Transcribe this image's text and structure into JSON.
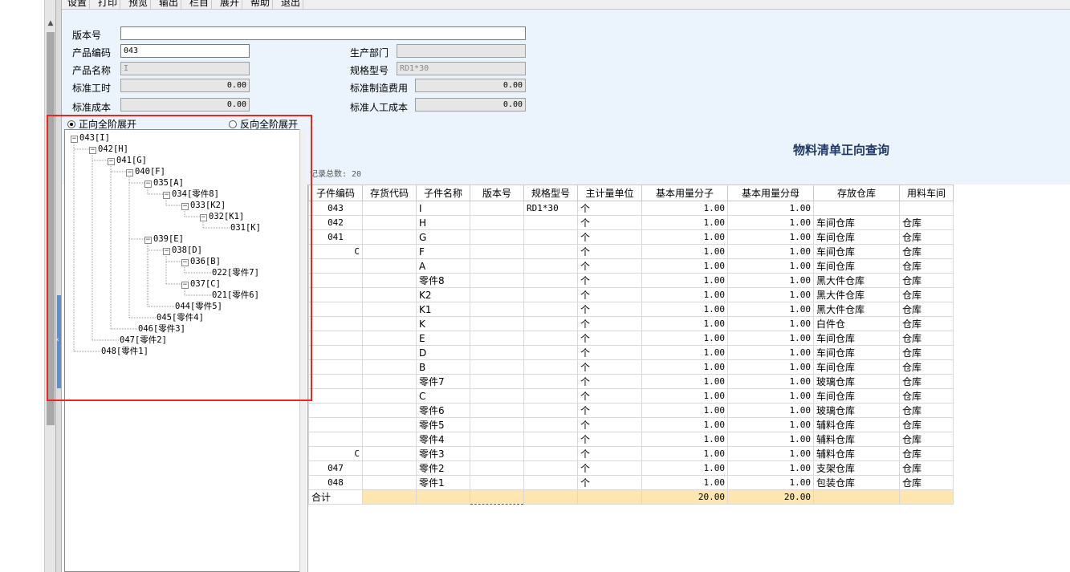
{
  "menu": [
    "设置",
    "打印",
    "预览",
    "输出",
    "栏目",
    "展开",
    "帮助",
    "退出"
  ],
  "form": {
    "version_label": "版本号",
    "version_value": "",
    "product_code_label": "产品编码",
    "product_code_value": "043",
    "product_name_label": "产品名称",
    "product_name_value": "I",
    "std_hours_label": "标准工时",
    "std_hours_value": "0.00",
    "std_cost_label": "标准成本",
    "std_cost_value": "0.00",
    "dept_label": "生产部门",
    "dept_value": "",
    "spec_label": "规格型号",
    "spec_value": "RD1*30",
    "std_mfg_cost_label": "标准制造费用",
    "std_mfg_cost_value": "0.00",
    "std_labor_cost_label": "标准人工成本",
    "std_labor_cost_value": "0.00"
  },
  "page_title": "物料清单正向查询",
  "record_count": "记录总数: 20",
  "expand_options": {
    "forward": "正向全阶展开",
    "reverse": "反向全阶展开",
    "selected": "forward"
  },
  "tree": [
    {
      "label": "043[I]",
      "depth": 0,
      "expandable": true
    },
    {
      "label": "042[H]",
      "depth": 1,
      "expandable": true
    },
    {
      "label": "041[G]",
      "depth": 2,
      "expandable": true
    },
    {
      "label": "040[F]",
      "depth": 3,
      "expandable": true
    },
    {
      "label": "035[A]",
      "depth": 4,
      "expandable": true
    },
    {
      "label": "034[零件8]",
      "depth": 5,
      "expandable": true
    },
    {
      "label": "033[K2]",
      "depth": 6,
      "expandable": true
    },
    {
      "label": "032[K1]",
      "depth": 7,
      "expandable": true
    },
    {
      "label": "031[K]",
      "depth": 8,
      "expandable": false
    },
    {
      "label": "039[E]",
      "depth": 4,
      "expandable": true
    },
    {
      "label": "038[D]",
      "depth": 5,
      "expandable": true
    },
    {
      "label": "036[B]",
      "depth": 6,
      "expandable": true
    },
    {
      "label": "022[零件7]",
      "depth": 7,
      "expandable": false
    },
    {
      "label": "037[C]",
      "depth": 6,
      "expandable": true
    },
    {
      "label": "021[零件6]",
      "depth": 7,
      "expandable": false
    },
    {
      "label": "044[零件5]",
      "depth": 5,
      "expandable": false
    },
    {
      "label": "045[零件4]",
      "depth": 4,
      "expandable": false
    },
    {
      "label": "046[零件3]",
      "depth": 3,
      "expandable": false
    },
    {
      "label": "047[零件2]",
      "depth": 2,
      "expandable": false
    },
    {
      "label": "048[零件1]",
      "depth": 1,
      "expandable": false
    }
  ],
  "grid": {
    "columns": [
      "子件编码",
      "存货代码",
      "子件名称",
      "版本号",
      "规格型号",
      "主计量单位",
      "基本用量分子",
      "基本用量分母",
      "存放仓库",
      "用料车间"
    ],
    "rows": [
      [
        "043",
        "",
        "I",
        "",
        "RD1*30",
        "个",
        "1.00",
        "1.00",
        "",
        ""
      ],
      [
        "042",
        "",
        "H",
        "",
        "",
        "个",
        "1.00",
        "1.00",
        "车间仓库",
        "仓库"
      ],
      [
        "041",
        "",
        "G",
        "",
        "",
        "个",
        "1.00",
        "1.00",
        "车间仓库",
        "仓库"
      ],
      [
        "C",
        "",
        "F",
        "",
        "",
        "个",
        "1.00",
        "1.00",
        "车间仓库",
        "仓库"
      ],
      [
        "",
        "",
        "A",
        "",
        "",
        "个",
        "1.00",
        "1.00",
        "车间仓库",
        "仓库"
      ],
      [
        "",
        "",
        "零件8",
        "",
        "",
        "个",
        "1.00",
        "1.00",
        "黑大件仓库",
        "仓库"
      ],
      [
        "",
        "",
        "K2",
        "",
        "",
        "个",
        "1.00",
        "1.00",
        "黑大件仓库",
        "仓库"
      ],
      [
        "",
        "",
        "K1",
        "",
        "",
        "个",
        "1.00",
        "1.00",
        "黑大件仓库",
        "仓库"
      ],
      [
        "",
        "",
        "K",
        "",
        "",
        "个",
        "1.00",
        "1.00",
        "白件仓",
        "仓库"
      ],
      [
        "",
        "",
        "E",
        "",
        "",
        "个",
        "1.00",
        "1.00",
        "车间仓库",
        "仓库"
      ],
      [
        "",
        "",
        "D",
        "",
        "",
        "个",
        "1.00",
        "1.00",
        "车间仓库",
        "仓库"
      ],
      [
        "",
        "",
        "B",
        "",
        "",
        "个",
        "1.00",
        "1.00",
        "车间仓库",
        "仓库"
      ],
      [
        "",
        "",
        "零件7",
        "",
        "",
        "个",
        "1.00",
        "1.00",
        "玻璃仓库",
        "仓库"
      ],
      [
        "",
        "",
        "C",
        "",
        "",
        "个",
        "1.00",
        "1.00",
        "车间仓库",
        "仓库"
      ],
      [
        "",
        "",
        "零件6",
        "",
        "",
        "个",
        "1.00",
        "1.00",
        "玻璃仓库",
        "仓库"
      ],
      [
        "",
        "",
        "零件5",
        "",
        "",
        "个",
        "1.00",
        "1.00",
        "辅料仓库",
        "仓库"
      ],
      [
        "",
        "",
        "零件4",
        "",
        "",
        "个",
        "1.00",
        "1.00",
        "辅料仓库",
        "仓库"
      ],
      [
        "C",
        "",
        "零件3",
        "",
        "",
        "个",
        "1.00",
        "1.00",
        "辅料仓库",
        "仓库"
      ],
      [
        "047",
        "",
        "零件2",
        "",
        "",
        "个",
        "1.00",
        "1.00",
        "支架仓库",
        "仓库"
      ],
      [
        "048",
        "",
        "零件1",
        "",
        "",
        "个",
        "1.00",
        "1.00",
        "包装仓库",
        "仓库"
      ]
    ],
    "total_label": "合计",
    "total_numerator": "20.00",
    "total_denominator": "20.00"
  }
}
